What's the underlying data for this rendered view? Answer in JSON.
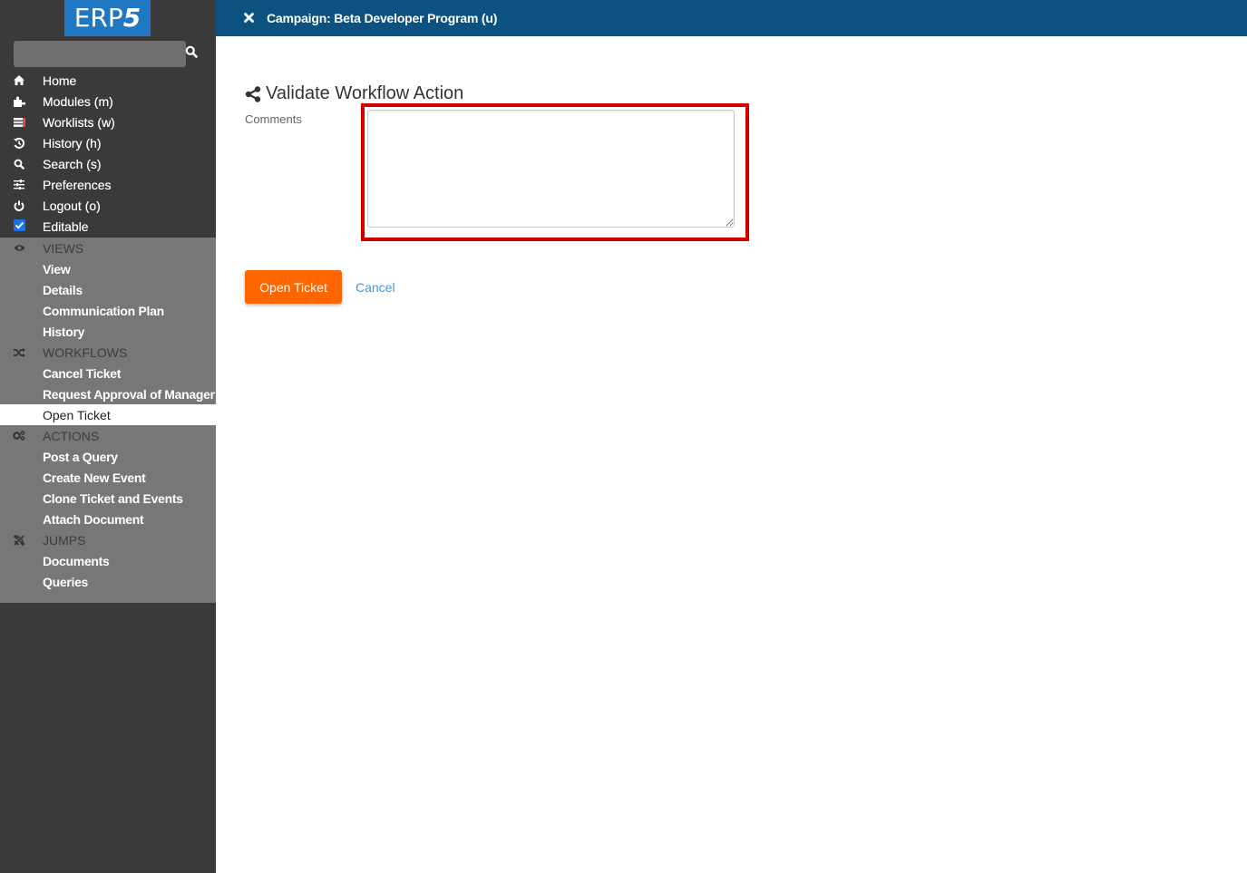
{
  "app": {
    "logo_text": "ERP",
    "logo_suffix": "5",
    "search": {
      "value": "",
      "placeholder": ""
    }
  },
  "sidebar": {
    "main_items": [
      {
        "label": "Home",
        "icon": "home-icon"
      },
      {
        "label": "Modules (m)",
        "icon": "puzzle-icon"
      },
      {
        "label": "Worklists (w)",
        "icon": "list-icon"
      },
      {
        "label": "History (h)",
        "icon": "history-icon"
      },
      {
        "label": "Search (s)",
        "icon": "search-icon"
      },
      {
        "label": "Preferences",
        "icon": "sliders-icon"
      },
      {
        "label": "Logout (o)",
        "icon": "power-icon"
      }
    ],
    "editable": {
      "label": "Editable",
      "checked": true
    },
    "groups": {
      "views": {
        "title": "VIEWS",
        "icon": "eye-icon",
        "items": [
          "View",
          "Details",
          "Communication Plan",
          "History"
        ]
      },
      "workflows": {
        "title": "WORKFLOWS",
        "icon": "random-icon",
        "items": [
          "Cancel Ticket",
          "Request Approval of Manager",
          "Open Ticket"
        ],
        "active": "Open Ticket"
      },
      "actions": {
        "title": "ACTIONS",
        "icon": "cogs-icon",
        "items": [
          "Post a Query",
          "Create New Event",
          "Clone Ticket and Events",
          "Attach Document"
        ]
      },
      "jumps": {
        "title": "JUMPS",
        "icon": "plane-icon",
        "items": [
          "Documents",
          "Queries"
        ]
      }
    }
  },
  "header": {
    "title": "Campaign: Beta Developer Program (u)",
    "close_icon": "close-icon"
  },
  "form": {
    "title": "Validate Workflow Action",
    "title_icon": "share-icon",
    "comments_label": "Comments",
    "comments_value": "",
    "submit_label": "Open Ticket",
    "cancel_label": "Cancel"
  },
  "colors": {
    "header_bg": "#0b5280",
    "sidebar_bg": "#3a3a3a",
    "group_bg": "#777777",
    "logo_bg": "#1f78c1",
    "primary_button": "#ff6600",
    "link": "#3b9bdd",
    "highlight": "#d40000"
  }
}
